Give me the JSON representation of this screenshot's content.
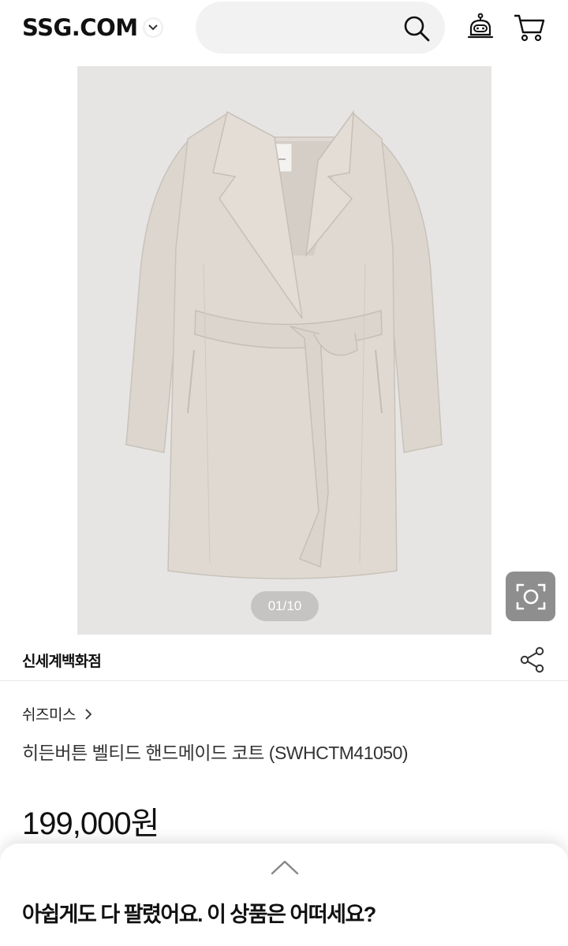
{
  "header": {
    "logo": "SSG.COM",
    "icons": [
      "chevron-down-icon",
      "search-icon",
      "bot-icon",
      "cart-icon"
    ]
  },
  "gallery": {
    "pager": "01/10",
    "icons": [
      "back-arrow-icon",
      "camera-icon"
    ]
  },
  "store": {
    "name": "신세계백화점",
    "icons": [
      "share-icon"
    ]
  },
  "product": {
    "brand": "쉬즈미스",
    "title": "히든버튼 벨티드 핸드메이드 코트 (SWHCTM41050)",
    "price": "199,000원"
  },
  "sheet": {
    "title": "아쉽게도 다 팔렸어요. 이 상품은 어떠세요?",
    "icons": [
      "chevron-up-icon"
    ]
  },
  "colors": {
    "image_bg": "#e6e5e3",
    "coat": "#dcd6cf",
    "pager_bg": "#bebebc",
    "camera_bg": "#8e8e8e"
  }
}
